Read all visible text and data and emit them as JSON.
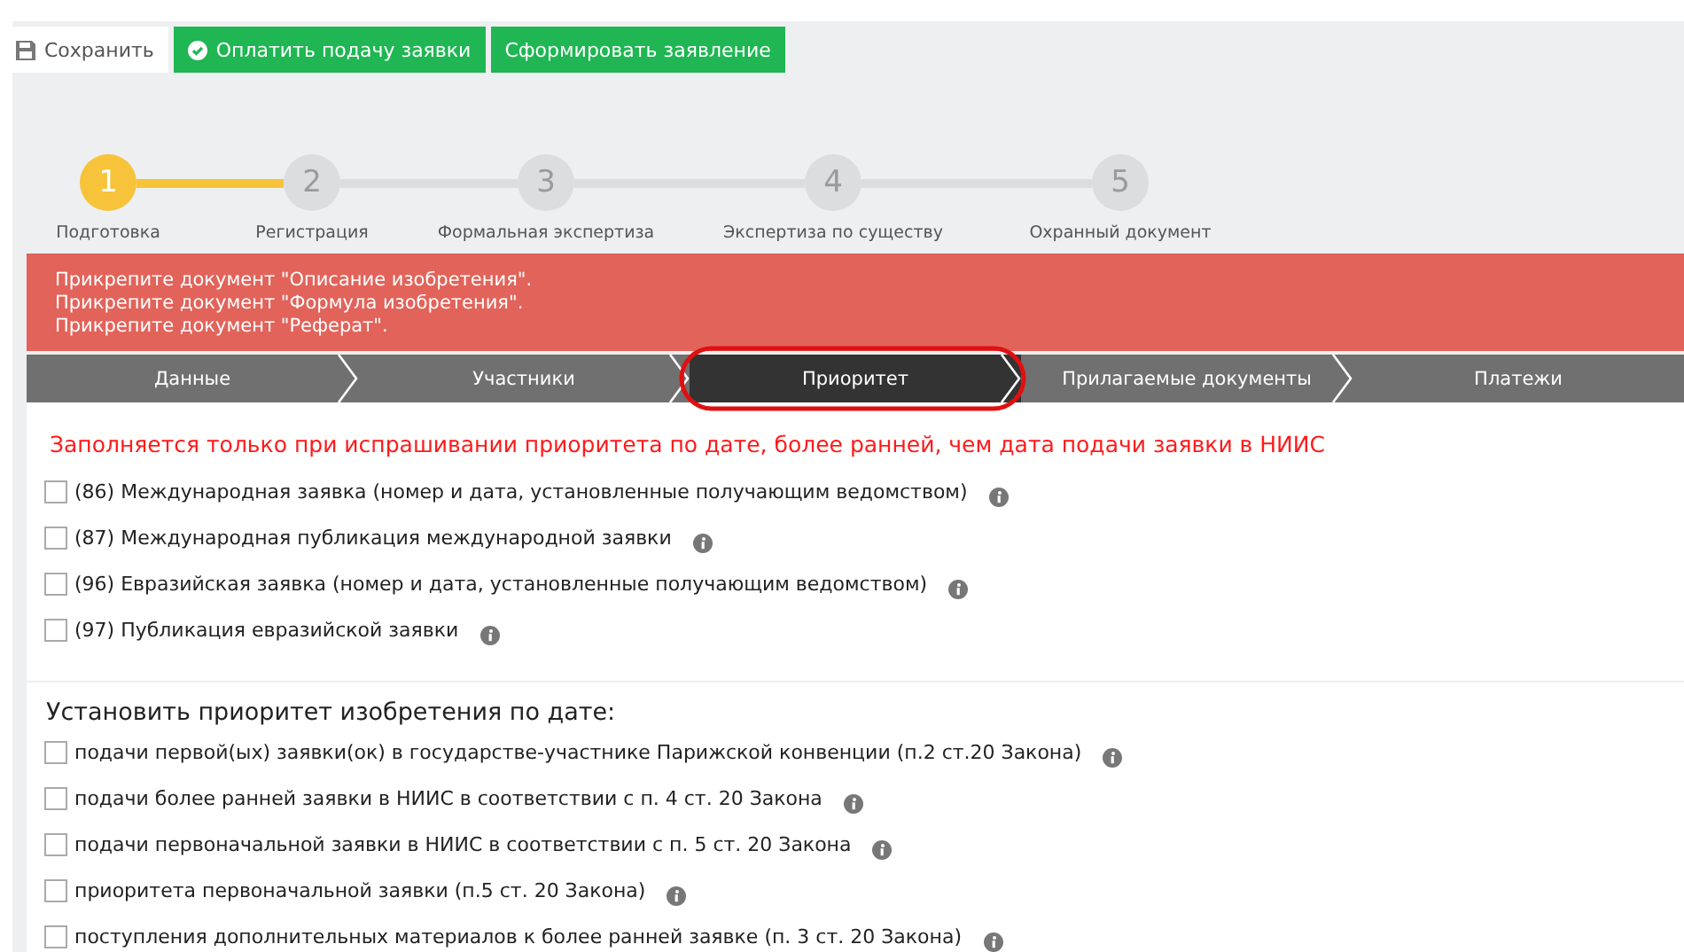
{
  "toolbar": {
    "buttons": [
      {
        "label": "Сохранить",
        "kind": "save"
      },
      {
        "label": "Оплатить подачу заявки",
        "kind": "pay"
      },
      {
        "label": "Сформировать заявление",
        "kind": "form"
      }
    ]
  },
  "steps": [
    {
      "number": "1",
      "label": "Подготовка",
      "selected": true
    },
    {
      "number": "2",
      "label": "Регистрация",
      "selected": false
    },
    {
      "number": "3",
      "label": "Формальная экспертиза",
      "selected": false
    },
    {
      "number": "4",
      "label": "Экспертиза по существу",
      "selected": false
    },
    {
      "number": "5",
      "label": "Охранный документ",
      "selected": false
    }
  ],
  "alert": {
    "messages": [
      "Прикрепите документ \"Описание изобретения\".",
      "Прикрепите документ \"Формула изобретения\".",
      "Прикрепите документ \"Реферат\"."
    ]
  },
  "tabs": [
    {
      "label": "Данные",
      "selected": false
    },
    {
      "label": "Участники",
      "selected": false
    },
    {
      "label": "Приоритет",
      "selected": true
    },
    {
      "label": "Прилагаемые документы",
      "selected": false
    },
    {
      "label": "Платежи",
      "selected": false
    }
  ],
  "notice": "Заполняется только при испрашивании приоритета по дате, более ранней, чем дата подачи заявки в НИИС",
  "group_1": {
    "items": [
      {
        "label": "(86) Международная заявка (номер и дата, установленные получающим ведомством)",
        "checked": false
      },
      {
        "label": "(87) Международная публикация международной заявки",
        "checked": false
      },
      {
        "label": "(96) Евразийская заявка (номер и дата, установленные получающим ведомством)",
        "checked": false
      },
      {
        "label": "(97) Публикация евразийской заявки",
        "checked": false
      }
    ]
  },
  "group_2": {
    "title": "Установить приоритет изобретения по дате:",
    "items": [
      {
        "label": "подачи первой(ых) заявки(ок) в государстве-участнике Парижской конвенции (п.2 ст.20 Закона)",
        "checked": false
      },
      {
        "label": "подачи более ранней заявки в НИИС в соответствии с п. 4 ст. 20 Закона",
        "checked": false
      },
      {
        "label": "подачи первоначальной заявки в НИИС в соответствии с п. 5 ст. 20 Закона",
        "checked": false
      },
      {
        "label": "приоритета первоначальной заявки (п.5 ст. 20 Закона)",
        "checked": false
      },
      {
        "label": "поступления дополнительных материалов к более ранней заявке (п. 3 ст. 20 Закона)",
        "checked": false
      }
    ]
  }
}
